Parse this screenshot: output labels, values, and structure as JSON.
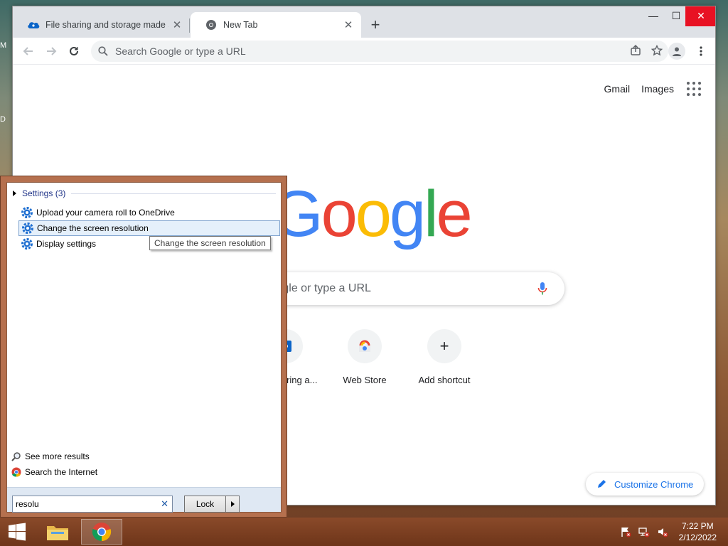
{
  "desktop": {
    "edge_letters": [
      "M",
      "D"
    ]
  },
  "browser": {
    "tabs": [
      {
        "title": "File sharing and storage made si",
        "icon": "onedrive-icon"
      },
      {
        "title": "New Tab",
        "icon": "chrome-icon"
      }
    ],
    "window_controls": {
      "minimize": "—",
      "maximize": "☐",
      "close": "✕"
    },
    "omnibox": {
      "placeholder": "Search Google or type a URL"
    },
    "toplinks": {
      "gmail": "Gmail",
      "images": "Images"
    },
    "logo_letters": [
      {
        "ch": "G",
        "color": "#4285f4"
      },
      {
        "ch": "o",
        "color": "#ea4335"
      },
      {
        "ch": "o",
        "color": "#fbbc05"
      },
      {
        "ch": "g",
        "color": "#4285f4"
      },
      {
        "ch": "l",
        "color": "#34a853"
      },
      {
        "ch": "e",
        "color": "#ea4335"
      }
    ],
    "search_placeholder": "Search Google or type a URL",
    "shortcuts": [
      {
        "label": "File sharing a...",
        "icon": "onedrive-icon"
      },
      {
        "label": "Web Store",
        "icon": "webstore-icon"
      },
      {
        "label": "Add shortcut",
        "icon": "plus-icon"
      }
    ],
    "customize_label": "Customize Chrome"
  },
  "start_menu": {
    "group_header": "Settings (3)",
    "items": [
      {
        "label": "Upload your camera roll to OneDrive",
        "selected": false
      },
      {
        "label": "Change the screen resolution",
        "selected": true
      },
      {
        "label": "Display settings",
        "selected": false
      }
    ],
    "tooltip": "Change the screen resolution",
    "see_more": "See more results",
    "search_internet": "Search the Internet",
    "search_value": "resolu",
    "lock_label": "Lock"
  },
  "taskbar": {
    "time": "7:22 PM",
    "date": "2/12/2022"
  },
  "colors": {
    "accent": "#1a73e8",
    "startmenu_frame": "#b5704e"
  }
}
